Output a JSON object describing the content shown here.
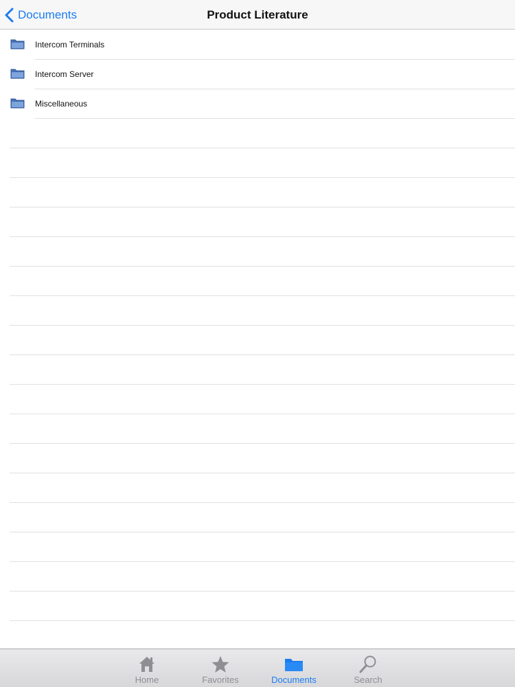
{
  "nav": {
    "back_label": "Documents",
    "title": "Product Literature"
  },
  "list": {
    "items": [
      {
        "label": "Intercom Terminals",
        "icon": "folder-icon"
      },
      {
        "label": "Intercom Server",
        "icon": "folder-icon"
      },
      {
        "label": "Miscellaneous",
        "icon": "folder-icon"
      }
    ]
  },
  "tabs": [
    {
      "label": "Home",
      "icon": "home-icon",
      "active": false
    },
    {
      "label": "Favorites",
      "icon": "star-icon",
      "active": false
    },
    {
      "label": "Documents",
      "icon": "folder-icon",
      "active": true
    },
    {
      "label": "Search",
      "icon": "search-icon",
      "active": false
    }
  ],
  "colors": {
    "accent": "#1a7cf0",
    "inactive": "#8e8e93",
    "separator": "#e0e0e3"
  }
}
